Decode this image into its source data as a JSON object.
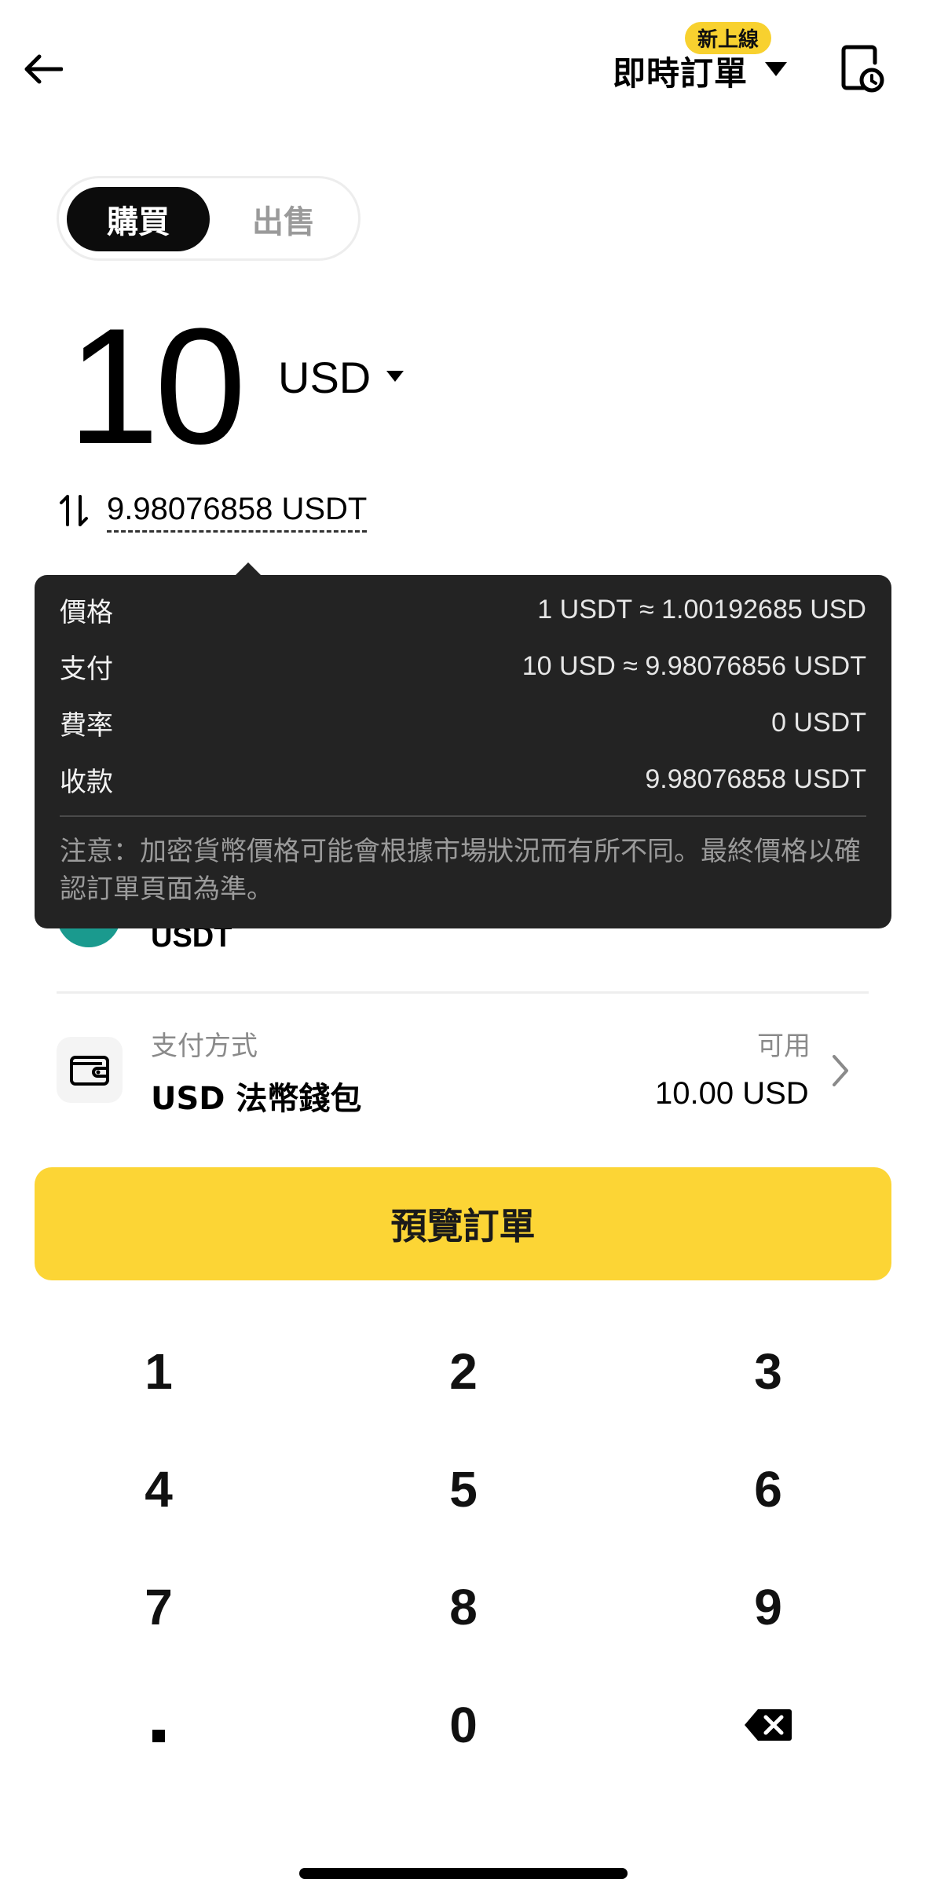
{
  "header": {
    "order_type_label": "即時訂單",
    "new_badge": "新上線"
  },
  "tabs": {
    "buy": "購買",
    "sell": "出售",
    "selected": "buy"
  },
  "amount": {
    "value": "10",
    "currency": "USD"
  },
  "conversion": {
    "value": "9.98076858 USDT"
  },
  "tooltip": {
    "rows": [
      {
        "label": "價格",
        "value": "1 USDT ≈ 1.00192685 USD"
      },
      {
        "label": "支付",
        "value": "10 USD ≈ 9.98076856 USDT"
      },
      {
        "label": "費率",
        "value": "0 USDT"
      },
      {
        "label": "收款",
        "value": "9.98076858 USDT"
      }
    ],
    "note": "注意：加密貨幣價格可能會根據市場狀況而有所不同。最終價格以確認訂單頁面為準。"
  },
  "asset": {
    "label": "USDT"
  },
  "payment": {
    "caption": "支付方式",
    "name": "USD 法幣錢包",
    "available_caption": "可用",
    "available_value": "10.00 USD"
  },
  "preview_button": "預覽訂單",
  "keypad": {
    "keys": [
      "1",
      "2",
      "3",
      "4",
      "5",
      "6",
      "7",
      "8",
      "9",
      ".",
      "0",
      "backspace"
    ]
  },
  "colors": {
    "accent": "#fcd535",
    "badge": "#f8d12f",
    "tooltip_bg": "#232323",
    "asset_icon": "#1a9a8e"
  }
}
